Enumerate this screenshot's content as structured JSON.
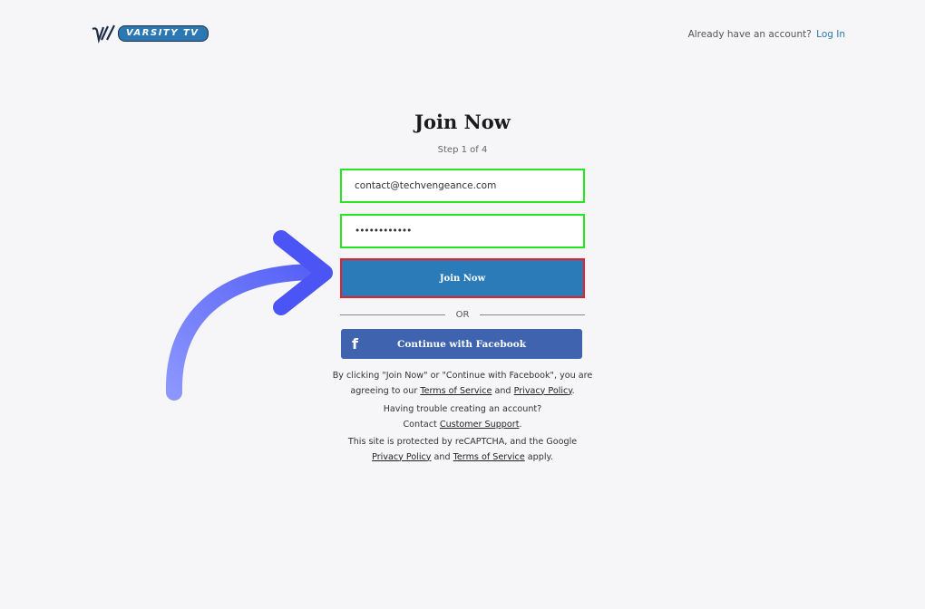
{
  "brand": {
    "name": "VARSITY TV"
  },
  "header": {
    "account_prompt": "Already have an account?",
    "login_link": "Log In"
  },
  "form": {
    "title": "Join Now",
    "step": "Step 1 of 4",
    "email_value": "contact@techvengeance.com",
    "password_value": "••••••••••••",
    "join_button": "Join Now",
    "or_text": "OR",
    "facebook_button": "Continue with Facebook"
  },
  "legal": {
    "terms_line1": "By clicking \"Join Now\" or \"Continue with Facebook\", you are",
    "terms_line2_prefix": "agreeing to our",
    "terms_of_service": "Terms of Service",
    "and": "and",
    "privacy_policy": "Privacy Policy",
    "period": ".",
    "trouble_line1": "Having trouble creating an account?",
    "contact_prefix": "Contact",
    "customer_support": "Customer Support",
    "recaptcha_line1": "This site is protected by reCAPTCHA, and the Google",
    "recaptcha_privacy": "Privacy Policy",
    "recaptcha_terms": "Terms of Service",
    "apply": "apply."
  },
  "icons": {
    "facebook": "facebook-icon",
    "arrow": "curved-arrow-annotation"
  },
  "colors": {
    "highlight_green": "#25e61f",
    "highlight_red": "#e8202a",
    "button_blue": "#2b7bb9",
    "facebook_blue": "#3f63ae",
    "arrow": "#7b86ff"
  }
}
